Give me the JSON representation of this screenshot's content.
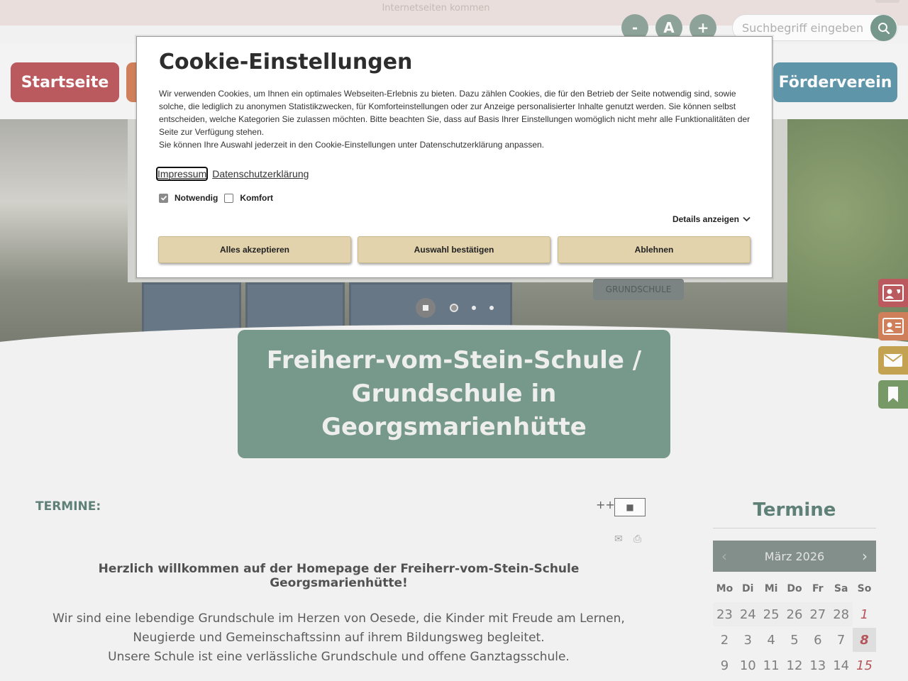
{
  "topbar": {
    "message": "Internetseiten kommen",
    "font_controls": [
      "-",
      "A",
      "+"
    ]
  },
  "search": {
    "placeholder": "Suchbegriff eingeben ..."
  },
  "nav": {
    "items": [
      {
        "label": "Startseite",
        "color": "#a8292f"
      },
      {
        "label": "",
        "color": "#c65a2a"
      },
      {
        "label": "Förderverein",
        "color": "#2f7790"
      }
    ]
  },
  "hero": {
    "sign_text": "GRUNDSCHULE",
    "title": "Freiherr-vom-Stein-Schule / Grundschule in Georgsmarienhütte"
  },
  "content": {
    "section_title": "TERMINE:",
    "font_size_label": "++-",
    "font_size_box": "■",
    "welcome_headline": "Herzlich willkommen auf der Homepage der Freiherr-vom-Stein-Schule Georgsmarienhütte!",
    "welcome_line1": "Wir sind eine lebendige Grundschule im Herzen von Oesede, die Kinder mit Freude am Lernen,",
    "welcome_line2": "Neugierde und Gemeinschaftssinn auf ihrem Bildungsweg begleitet.",
    "welcome_line3": "Unsere Schule ist eine verlässliche Grundschule und offene Ganztagsschule."
  },
  "calendar": {
    "title": "Termine",
    "month": "März 2026",
    "prev": "‹",
    "next": "›",
    "weekdays": [
      "Mo",
      "Di",
      "Mi",
      "Do",
      "Fr",
      "Sa",
      "So"
    ],
    "rows": [
      [
        "23",
        "24",
        "25",
        "26",
        "27",
        "28",
        "1"
      ],
      [
        "2",
        "3",
        "4",
        "5",
        "6",
        "7",
        "8"
      ],
      [
        "9",
        "10",
        "11",
        "12",
        "13",
        "14",
        "15"
      ]
    ]
  },
  "side_tabs": [
    {
      "icon": "phone-contact-icon",
      "color": "#a8292f"
    },
    {
      "icon": "contact-card-icon",
      "color": "#c65a2a"
    },
    {
      "icon": "mail-icon",
      "color": "#b58a1e"
    },
    {
      "icon": "bookmark-icon",
      "color": "#4f7d3a"
    }
  ],
  "cookie": {
    "title": "Cookie-Einstellungen",
    "text1": "Wir verwenden Cookies, um Ihnen ein optimales Webseiten-Erlebnis zu bieten. Dazu zählen Cookies, die für den Betrieb der Seite notwendig sind, sowie solche, die lediglich zu anonymen Statistikzwecken, für Komforteinstellungen oder zur Anzeige personalisierter Inhalte genutzt werden. Sie können selbst entscheiden, welche Kategorien Sie zulassen möchten. Bitte beachten Sie, dass auf Basis Ihrer Einstellungen womöglich nicht mehr alle Funktionalitäten der Seite zur Verfügung stehen.",
    "text2": "Sie können Ihre Auswahl jederzeit in den Cookie-Einstellungen unter Datenschutzerklärung anpassen.",
    "link_impressum": "Impressum",
    "link_privacy": "Datenschutzerklärung",
    "check_necessary": "Notwendig",
    "check_comfort": "Komfort",
    "details": "Details anzeigen",
    "btn_accept_all": "Alles akzeptieren",
    "btn_confirm": "Auswahl bestätigen",
    "btn_reject": "Ablehnen",
    "button_color": "#e2d3ad"
  }
}
